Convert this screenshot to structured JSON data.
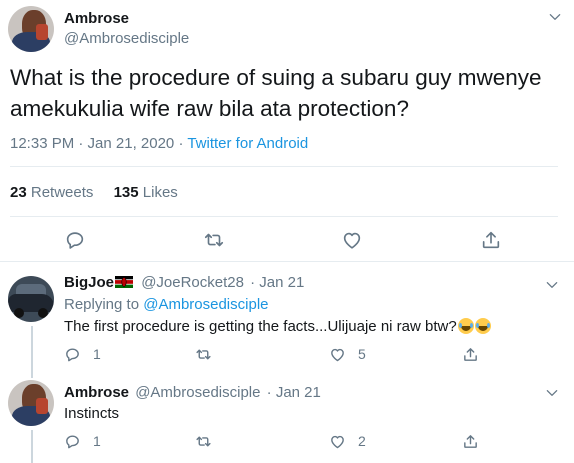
{
  "main_tweet": {
    "author_name": "Ambrose",
    "author_handle": "@Ambrosedisciple",
    "text": "What is the procedure of suing a subaru guy mwenye amekukulia wife raw bila ata protection?",
    "time": "12:33 PM · Jan 21, 2020 · ",
    "source": "Twitter for Android",
    "retweets_count": "23",
    "retweets_label": "Retweets",
    "likes_count": "135",
    "likes_label": "Likes",
    "icons": [
      "reply-icon",
      "retweet-icon",
      "like-icon",
      "share-icon",
      "chevron-down-icon"
    ]
  },
  "replies": [
    {
      "author_name": "BigJoe",
      "author_flag": "kenya-flag",
      "author_handle": "@JoeRocket28",
      "date": "· Jan 21",
      "replying_prefix": "Replying to ",
      "replying_to": "@Ambrosedisciple",
      "text": "The first procedure is getting the facts...Ulijuaje ni raw btw?",
      "emoji": [
        "tears-of-joy-emoji",
        "tears-of-joy-emoji"
      ],
      "reply_count": "1",
      "retweet_count": "",
      "like_count": "5"
    },
    {
      "author_name": "Ambrose",
      "author_handle": "@Ambrosedisciple",
      "date": "· Jan 21",
      "text": "Instincts",
      "reply_count": "1",
      "retweet_count": "",
      "like_count": "2"
    }
  ],
  "colors": {
    "text": "#14171a",
    "muted": "#657786",
    "link": "#1b95e0",
    "divider": "#e6ecf0",
    "thread_line": "#ccd6dd"
  }
}
